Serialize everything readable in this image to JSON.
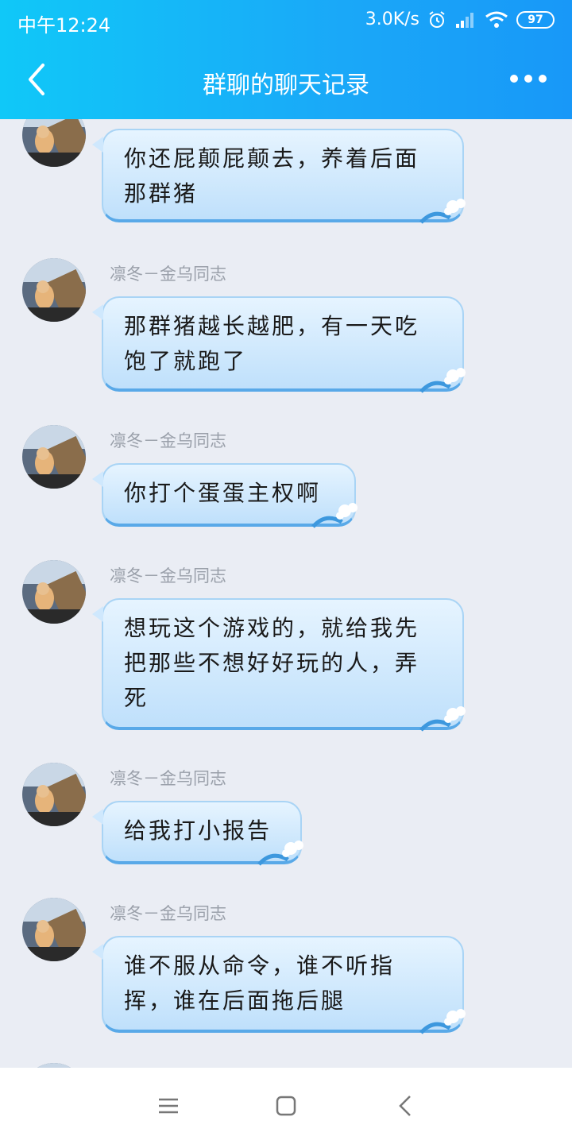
{
  "status_bar": {
    "time": "中午12:24",
    "speed": "3.0K/s",
    "battery": "97"
  },
  "header": {
    "title": "群聊的聊天记录"
  },
  "colors": {
    "header": "#1aa8f8",
    "bubble_border": "#59a9e8",
    "background": "#eaedf4"
  },
  "messages": [
    {
      "name": "",
      "text": "你还屁颠屁颠去，养着后面那群猪"
    },
    {
      "name": "凛冬－金乌同志",
      "text": "那群猪越长越肥，有一天吃饱了就跑了"
    },
    {
      "name": "凛冬－金乌同志",
      "text": "你打个蛋蛋主权啊"
    },
    {
      "name": "凛冬－金乌同志",
      "text": "想玩这个游戏的，就给我先把那些不想好好玩的人，弄死"
    },
    {
      "name": "凛冬－金乌同志",
      "text": "给我打小报告"
    },
    {
      "name": "凛冬－金乌同志",
      "text": "谁不服从命令，谁不听指挥，谁在后面拖后腿"
    }
  ],
  "icons": [
    "back-icon",
    "more-icon",
    "alarm-icon",
    "signal-icon",
    "wifi-icon",
    "battery-icon",
    "menu-icon",
    "home-icon",
    "nav-back-icon"
  ]
}
